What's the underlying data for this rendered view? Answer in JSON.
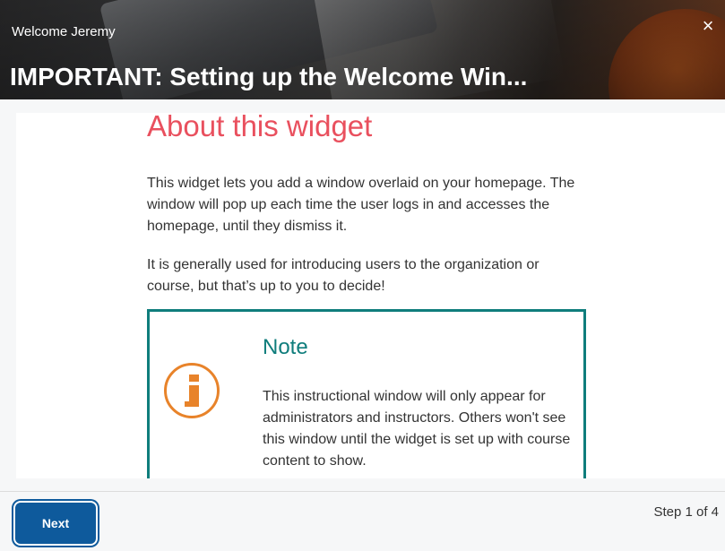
{
  "header": {
    "welcome": "Welcome Jeremy",
    "title": "IMPORTANT: Setting up the Welcome Win...",
    "close_icon": "close-icon",
    "close_glyph": "×"
  },
  "content": {
    "heading": "About this widget",
    "paragraphs": [
      "This widget lets you add a window overlaid on your homepage. The window will pop up each time the user logs in and accesses the homepage, until they dismiss it.",
      "It is generally used for introducing users to the organization or course, but that’s up to you to decide!"
    ],
    "note": {
      "title": "Note",
      "icon": "info-icon",
      "text": "This instructional window will only appear for administrators and instructors. Others won't see this window until the widget is set up with course content to show."
    }
  },
  "footer": {
    "next_label": "Next",
    "step_text": "Step 1 of 4"
  },
  "colors": {
    "heading": "#e9505e",
    "note_accent": "#0f7d7c",
    "info_icon": "#e8832a",
    "primary_button": "#0e5a9c"
  }
}
